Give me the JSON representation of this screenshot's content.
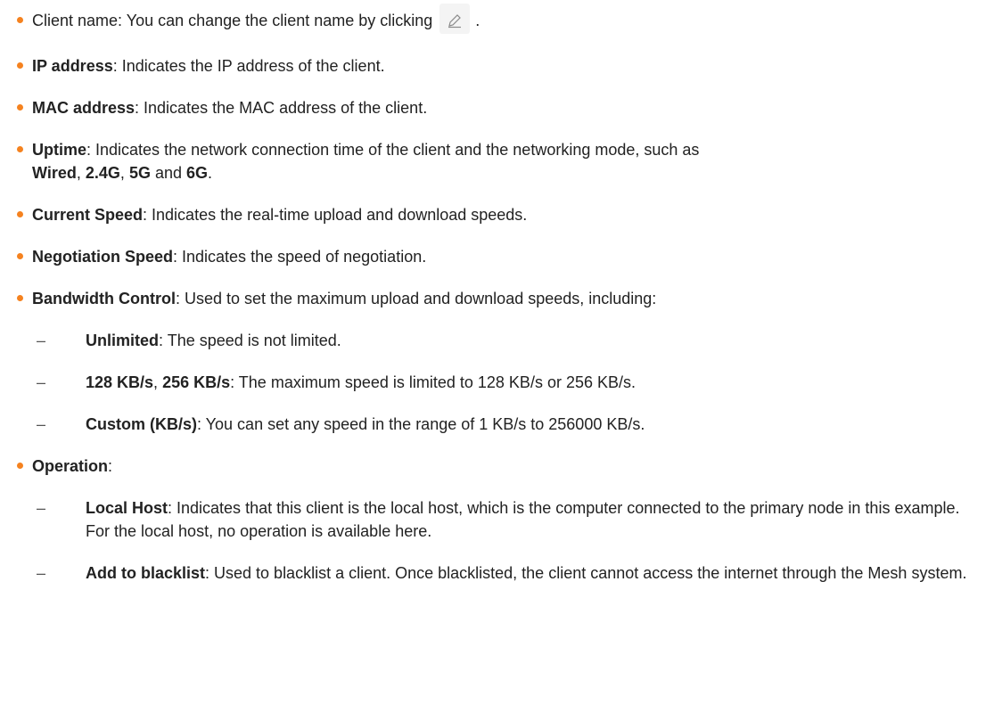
{
  "client_name": {
    "text": "Client name: You can change the client name by clicking",
    "after_icon": ".",
    "icon": "edit-pencil-icon"
  },
  "ip_address": {
    "term": "IP address",
    "desc": ": Indicates the IP address of the client."
  },
  "mac_address": {
    "term": "MAC address",
    "desc": ": Indicates the MAC address of the client."
  },
  "uptime": {
    "term": "Uptime",
    "desc": ": Indicates the network connection time of the client and the networking mode, such as",
    "mode1": "Wired",
    "sep1": ",",
    "mode2": "2.4G",
    "sep2": ",",
    "mode3": "5G",
    "sep3": "and",
    "mode4": "6G",
    "end": "."
  },
  "current_speed": {
    "term": "Current Speed",
    "desc": ": Indicates the real-time upload and download speeds."
  },
  "negotiation_speed": {
    "term": "Negotiation Speed",
    "desc": ": Indicates the speed of negotiation."
  },
  "bandwidth_control": {
    "term": "Bandwidth Control",
    "desc": ": Used to set the maximum upload and download speeds, including:",
    "dash": "–",
    "unlimited": {
      "term": "Unlimited",
      "desc": ": The speed is not limited."
    },
    "fixed": {
      "term1": "128 KB/s",
      "sep": ",",
      "term2": "256 KB/s",
      "desc": ": The maximum speed is limited to 128 KB/s or 256 KB/s."
    },
    "custom": {
      "term": "Custom (KB/s)",
      "desc": ": You can set any speed in the range of 1 KB/s to 256000 KB/s."
    }
  },
  "operation": {
    "term": "Operation",
    "colon": ":",
    "dash": "–",
    "local_host": {
      "term": "Local Host",
      "desc": ": Indicates that this client is the local host, which is the computer connected to the primary node in this example. For the local host, no operation is available here."
    },
    "blacklist": {
      "term": "Add to blacklist",
      "desc": ": Used to blacklist a client. Once blacklisted, the client cannot access the internet through the Mesh system."
    }
  },
  "colors": {
    "bullet": "#f5821f",
    "text": "#222222"
  }
}
